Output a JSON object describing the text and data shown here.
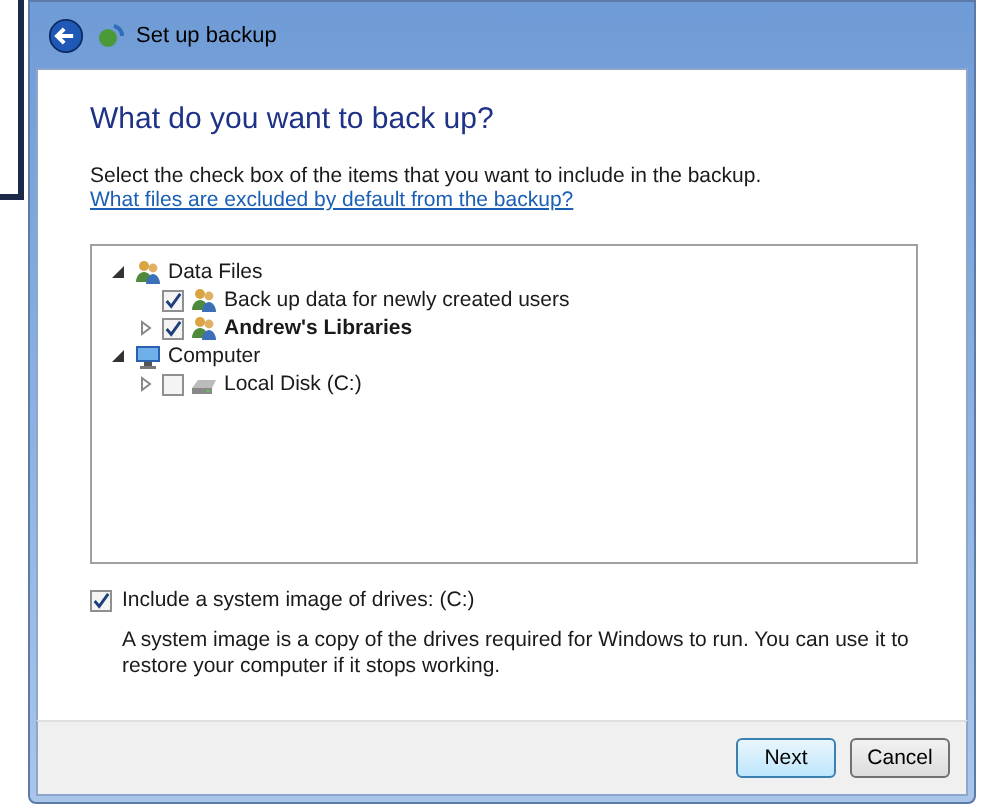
{
  "window": {
    "title": "Set up backup"
  },
  "heading": "What do you want to back up?",
  "instruction": "Select the check box of the items that you want to include in the backup.",
  "help_link": "What files are excluded by default from the backup?",
  "tree": [
    {
      "label": "Data Files",
      "kind": "group",
      "expanded": true,
      "bold": false,
      "children": [
        {
          "label": "Back up data for newly created users",
          "kind": "leaf",
          "checked": true,
          "bold": false
        },
        {
          "label": "Andrew's Libraries",
          "kind": "checkable",
          "checked": true,
          "expanded": false,
          "bold": true
        }
      ]
    },
    {
      "label": "Computer",
      "kind": "group",
      "expanded": true,
      "bold": false,
      "children": [
        {
          "label": "Local Disk (C:)",
          "kind": "checkable",
          "checked": false,
          "expanded": false,
          "bold": false
        }
      ]
    }
  ],
  "system_image": {
    "label": "Include a system image of drives: (C:)",
    "checked": true
  },
  "note": "A system image is a copy of the drives required for Windows to run. You can use it to restore your computer if it stops working.",
  "buttons": [
    {
      "label": "Next",
      "default": true
    },
    {
      "label": "Cancel",
      "default": false
    }
  ]
}
